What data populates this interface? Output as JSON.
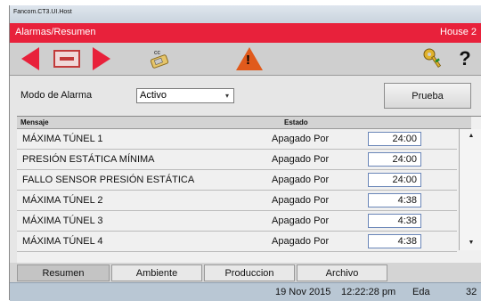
{
  "window": {
    "title": "Fancom.CT3.UI.Host"
  },
  "header": {
    "screen_title": "Alarmas/Resumen",
    "house": "House 2"
  },
  "toolbar": {
    "back_icon": "arrow-left-icon",
    "panel_icon": "panel-icon",
    "forward_icon": "arrow-right-icon",
    "cc_icon_label": "cc",
    "warning_icon": "warning-icon",
    "warning_symbol": "!",
    "key_icon": "key-icon",
    "help_symbol": "?"
  },
  "mode": {
    "label": "Modo de Alarma",
    "value": "Activo",
    "test_button": "Prueba"
  },
  "table": {
    "columns": [
      "Mensaje",
      "Estado"
    ],
    "rows": [
      {
        "message": "MÁXIMA TÚNEL 1",
        "state": "Apagado Por",
        "time": "24:00"
      },
      {
        "message": "PRESIÓN ESTÁTICA MÍNIMA",
        "state": "Apagado Por",
        "time": "24:00"
      },
      {
        "message": "FALLO SENSOR PRESIÓN ESTÁTICA",
        "state": "Apagado Por",
        "time": "24:00"
      },
      {
        "message": "MÁXIMA TÚNEL 2",
        "state": "Apagado Por",
        "time": "4:38"
      },
      {
        "message": "MÁXIMA TÚNEL 3",
        "state": "Apagado Por",
        "time": "4:38"
      },
      {
        "message": "MÁXIMA TÚNEL 4",
        "state": "Apagado Por",
        "time": "4:38"
      }
    ]
  },
  "tabs": [
    "Resumen",
    "Ambiente",
    "Produccion",
    "Archivo"
  ],
  "status": {
    "date": "19 Nov 2015",
    "time": "12:22:28 pm",
    "user": "Eda",
    "number": "32"
  },
  "colors": {
    "header_red": "#e8213b",
    "status_blue": "#b9c7d4"
  }
}
